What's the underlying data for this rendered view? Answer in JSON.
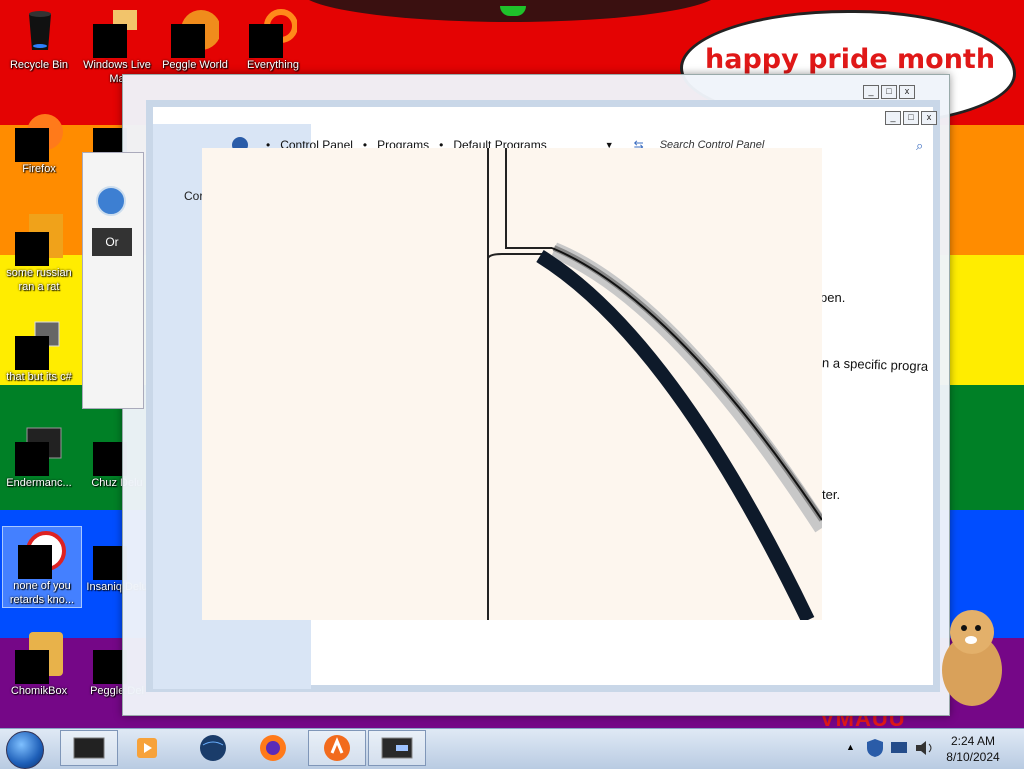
{
  "desktop": {
    "banner": "happy pride month",
    "stripe_colors": [
      "#e40303",
      "#ff8c00",
      "#ffed00",
      "#008026",
      "#004dff",
      "#750787"
    ],
    "icons": [
      {
        "label": "Recycle Bin",
        "glyph": "recycle-bin-icon"
      },
      {
        "label": "Windows Live Ma",
        "glyph": "windows-live-icon"
      },
      {
        "label": "Peggle World",
        "glyph": "peggle-icon"
      },
      {
        "label": "Everything",
        "glyph": "everything-icon"
      },
      {
        "label": "Firefox",
        "glyph": "firefox-icon"
      },
      {
        "label": "some russian ran a rat",
        "glyph": "app-icon"
      },
      {
        "label": "that but its c#",
        "glyph": "folder-stack-icon"
      },
      {
        "label": "Endermanc...",
        "glyph": "app-icon"
      },
      {
        "label": "Chuz Delu",
        "glyph": "app-icon"
      },
      {
        "label": "none of you retards kno...",
        "glyph": "app-icon"
      },
      {
        "label": "Insaniq Delu",
        "glyph": "app-icon"
      },
      {
        "label": "ChomikBox",
        "glyph": "chomikbox-icon"
      },
      {
        "label": "Peggle Del",
        "glyph": "peggle-icon"
      }
    ]
  },
  "small_window": {
    "tab_label": "Or"
  },
  "control_panel": {
    "breadcrumb": [
      "Control Panel",
      "Programs",
      "Default Programs"
    ],
    "search_placeholder": "Search Control Panel",
    "left_text": "Cor",
    "content_fragments": [
      "pen.",
      "n a specific progra",
      "ter."
    ]
  },
  "taskbar": {
    "buttons": [
      "taskbar-window-icon",
      "media-player-icon",
      "globe-icon",
      "firefox-icon",
      "avast-icon",
      "display-icon"
    ],
    "time": "2:24 AM",
    "date": "8/10/2024"
  },
  "overlay": {
    "partial_text": "VMAUU"
  }
}
